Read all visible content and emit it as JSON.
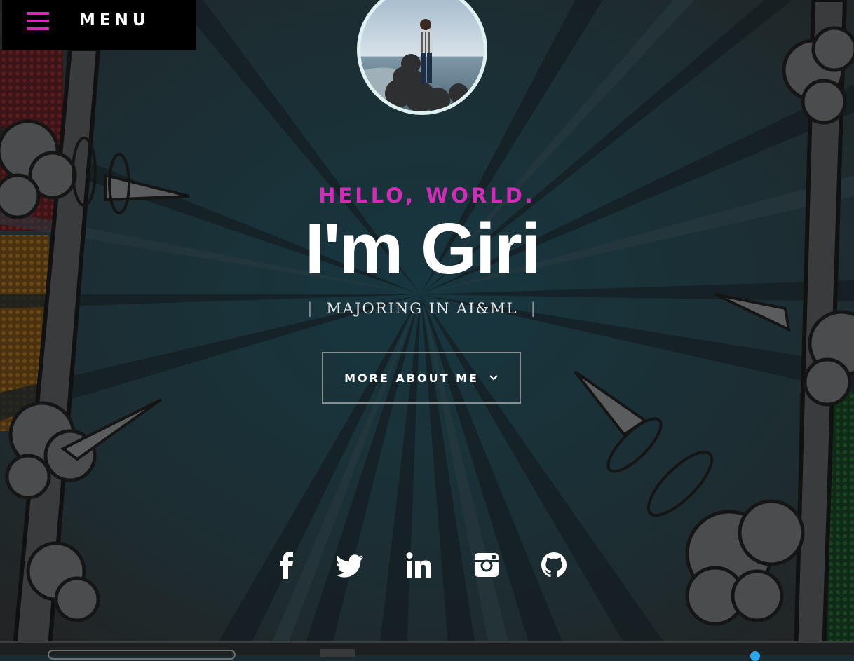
{
  "nav": {
    "menu_label": "MENU"
  },
  "hero": {
    "greeting": "HELLO, WORLD.",
    "name": "I'm Giri",
    "tagline_divider_left": "|",
    "tagline": "MAJORING IN AI&ML",
    "tagline_divider_right": "|",
    "cta_label": "MORE ABOUT ME"
  },
  "social_links": [
    {
      "name": "facebook",
      "icon": "facebook-icon"
    },
    {
      "name": "twitter",
      "icon": "twitter-icon"
    },
    {
      "name": "linkedin",
      "icon": "linkedin-icon"
    },
    {
      "name": "instagram",
      "icon": "instagram-icon"
    },
    {
      "name": "github",
      "icon": "github-icon"
    }
  ],
  "colors": {
    "accent": "#d22bb8",
    "background": "#1a2b31",
    "text": "#ffffff",
    "menu_bg": "#000000"
  }
}
